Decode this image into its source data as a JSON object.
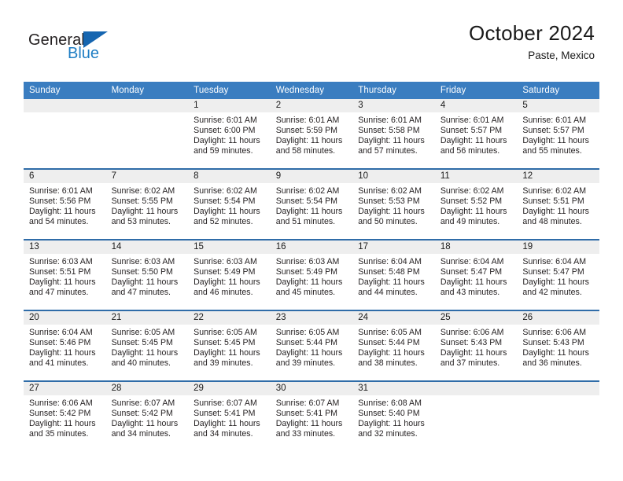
{
  "brand": {
    "name_top": "General",
    "name_bottom": "Blue",
    "triangle_icon": "blue-triangle-logo",
    "accent_color": "#1f7ec4"
  },
  "header": {
    "title": "October 2024",
    "location": "Paste, Mexico"
  },
  "theme": {
    "header_blue": "#3a7dc0",
    "row_rule_blue": "#2f6ca8",
    "daynum_band_gray": "#eeeeee",
    "text_color": "#231f20"
  },
  "weekdays": [
    "Sunday",
    "Monday",
    "Tuesday",
    "Wednesday",
    "Thursday",
    "Friday",
    "Saturday"
  ],
  "weeks": [
    [
      {
        "day": "",
        "empty": true
      },
      {
        "day": "",
        "empty": true
      },
      {
        "day": "1",
        "sunrise": "Sunrise: 6:01 AM",
        "sunset": "Sunset: 6:00 PM",
        "daylight1": "Daylight: 11 hours",
        "daylight2": "and 59 minutes."
      },
      {
        "day": "2",
        "sunrise": "Sunrise: 6:01 AM",
        "sunset": "Sunset: 5:59 PM",
        "daylight1": "Daylight: 11 hours",
        "daylight2": "and 58 minutes."
      },
      {
        "day": "3",
        "sunrise": "Sunrise: 6:01 AM",
        "sunset": "Sunset: 5:58 PM",
        "daylight1": "Daylight: 11 hours",
        "daylight2": "and 57 minutes."
      },
      {
        "day": "4",
        "sunrise": "Sunrise: 6:01 AM",
        "sunset": "Sunset: 5:57 PM",
        "daylight1": "Daylight: 11 hours",
        "daylight2": "and 56 minutes."
      },
      {
        "day": "5",
        "sunrise": "Sunrise: 6:01 AM",
        "sunset": "Sunset: 5:57 PM",
        "daylight1": "Daylight: 11 hours",
        "daylight2": "and 55 minutes."
      }
    ],
    [
      {
        "day": "6",
        "sunrise": "Sunrise: 6:01 AM",
        "sunset": "Sunset: 5:56 PM",
        "daylight1": "Daylight: 11 hours",
        "daylight2": "and 54 minutes."
      },
      {
        "day": "7",
        "sunrise": "Sunrise: 6:02 AM",
        "sunset": "Sunset: 5:55 PM",
        "daylight1": "Daylight: 11 hours",
        "daylight2": "and 53 minutes."
      },
      {
        "day": "8",
        "sunrise": "Sunrise: 6:02 AM",
        "sunset": "Sunset: 5:54 PM",
        "daylight1": "Daylight: 11 hours",
        "daylight2": "and 52 minutes."
      },
      {
        "day": "9",
        "sunrise": "Sunrise: 6:02 AM",
        "sunset": "Sunset: 5:54 PM",
        "daylight1": "Daylight: 11 hours",
        "daylight2": "and 51 minutes."
      },
      {
        "day": "10",
        "sunrise": "Sunrise: 6:02 AM",
        "sunset": "Sunset: 5:53 PM",
        "daylight1": "Daylight: 11 hours",
        "daylight2": "and 50 minutes."
      },
      {
        "day": "11",
        "sunrise": "Sunrise: 6:02 AM",
        "sunset": "Sunset: 5:52 PM",
        "daylight1": "Daylight: 11 hours",
        "daylight2": "and 49 minutes."
      },
      {
        "day": "12",
        "sunrise": "Sunrise: 6:02 AM",
        "sunset": "Sunset: 5:51 PM",
        "daylight1": "Daylight: 11 hours",
        "daylight2": "and 48 minutes."
      }
    ],
    [
      {
        "day": "13",
        "sunrise": "Sunrise: 6:03 AM",
        "sunset": "Sunset: 5:51 PM",
        "daylight1": "Daylight: 11 hours",
        "daylight2": "and 47 minutes."
      },
      {
        "day": "14",
        "sunrise": "Sunrise: 6:03 AM",
        "sunset": "Sunset: 5:50 PM",
        "daylight1": "Daylight: 11 hours",
        "daylight2": "and 47 minutes."
      },
      {
        "day": "15",
        "sunrise": "Sunrise: 6:03 AM",
        "sunset": "Sunset: 5:49 PM",
        "daylight1": "Daylight: 11 hours",
        "daylight2": "and 46 minutes."
      },
      {
        "day": "16",
        "sunrise": "Sunrise: 6:03 AM",
        "sunset": "Sunset: 5:49 PM",
        "daylight1": "Daylight: 11 hours",
        "daylight2": "and 45 minutes."
      },
      {
        "day": "17",
        "sunrise": "Sunrise: 6:04 AM",
        "sunset": "Sunset: 5:48 PM",
        "daylight1": "Daylight: 11 hours",
        "daylight2": "and 44 minutes."
      },
      {
        "day": "18",
        "sunrise": "Sunrise: 6:04 AM",
        "sunset": "Sunset: 5:47 PM",
        "daylight1": "Daylight: 11 hours",
        "daylight2": "and 43 minutes."
      },
      {
        "day": "19",
        "sunrise": "Sunrise: 6:04 AM",
        "sunset": "Sunset: 5:47 PM",
        "daylight1": "Daylight: 11 hours",
        "daylight2": "and 42 minutes."
      }
    ],
    [
      {
        "day": "20",
        "sunrise": "Sunrise: 6:04 AM",
        "sunset": "Sunset: 5:46 PM",
        "daylight1": "Daylight: 11 hours",
        "daylight2": "and 41 minutes."
      },
      {
        "day": "21",
        "sunrise": "Sunrise: 6:05 AM",
        "sunset": "Sunset: 5:45 PM",
        "daylight1": "Daylight: 11 hours",
        "daylight2": "and 40 minutes."
      },
      {
        "day": "22",
        "sunrise": "Sunrise: 6:05 AM",
        "sunset": "Sunset: 5:45 PM",
        "daylight1": "Daylight: 11 hours",
        "daylight2": "and 39 minutes."
      },
      {
        "day": "23",
        "sunrise": "Sunrise: 6:05 AM",
        "sunset": "Sunset: 5:44 PM",
        "daylight1": "Daylight: 11 hours",
        "daylight2": "and 39 minutes."
      },
      {
        "day": "24",
        "sunrise": "Sunrise: 6:05 AM",
        "sunset": "Sunset: 5:44 PM",
        "daylight1": "Daylight: 11 hours",
        "daylight2": "and 38 minutes."
      },
      {
        "day": "25",
        "sunrise": "Sunrise: 6:06 AM",
        "sunset": "Sunset: 5:43 PM",
        "daylight1": "Daylight: 11 hours",
        "daylight2": "and 37 minutes."
      },
      {
        "day": "26",
        "sunrise": "Sunrise: 6:06 AM",
        "sunset": "Sunset: 5:43 PM",
        "daylight1": "Daylight: 11 hours",
        "daylight2": "and 36 minutes."
      }
    ],
    [
      {
        "day": "27",
        "sunrise": "Sunrise: 6:06 AM",
        "sunset": "Sunset: 5:42 PM",
        "daylight1": "Daylight: 11 hours",
        "daylight2": "and 35 minutes."
      },
      {
        "day": "28",
        "sunrise": "Sunrise: 6:07 AM",
        "sunset": "Sunset: 5:42 PM",
        "daylight1": "Daylight: 11 hours",
        "daylight2": "and 34 minutes."
      },
      {
        "day": "29",
        "sunrise": "Sunrise: 6:07 AM",
        "sunset": "Sunset: 5:41 PM",
        "daylight1": "Daylight: 11 hours",
        "daylight2": "and 34 minutes."
      },
      {
        "day": "30",
        "sunrise": "Sunrise: 6:07 AM",
        "sunset": "Sunset: 5:41 PM",
        "daylight1": "Daylight: 11 hours",
        "daylight2": "and 33 minutes."
      },
      {
        "day": "31",
        "sunrise": "Sunrise: 6:08 AM",
        "sunset": "Sunset: 5:40 PM",
        "daylight1": "Daylight: 11 hours",
        "daylight2": "and 32 minutes."
      },
      {
        "day": "",
        "empty": true
      },
      {
        "day": "",
        "empty": true
      }
    ]
  ]
}
